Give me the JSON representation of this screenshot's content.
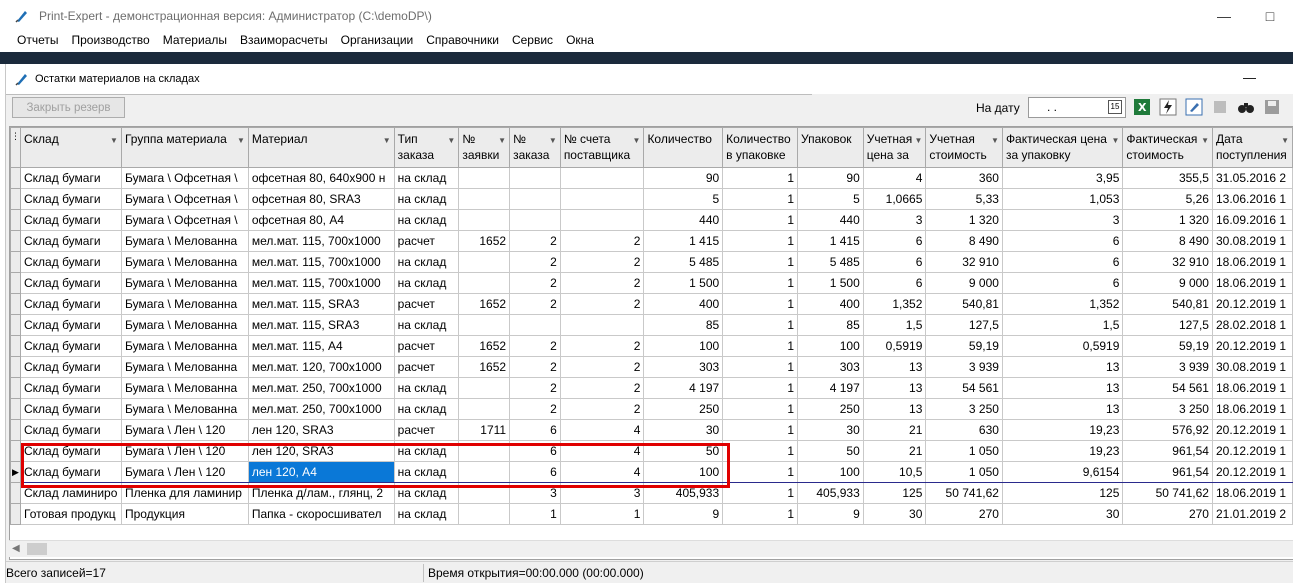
{
  "app": {
    "title": "Print-Expert - демонстрационная версия: Администратор (C:\\demoDP\\)",
    "menu": [
      "Отчеты",
      "Производство",
      "Материалы",
      "Взаиморасчеты",
      "Организации",
      "Справочники",
      "Сервис",
      "Окна"
    ],
    "minimize": "—",
    "maximize": "□"
  },
  "window": {
    "title": "Остатки материалов на складах",
    "minimize": "—"
  },
  "toolbar": {
    "close_reserve_label": "Закрыть резерв",
    "date_label": "На дату",
    "date_value": ". ."
  },
  "grid": {
    "columns": [
      "Склад",
      "Группа материала",
      "Материал",
      "Тип заказа",
      "№ заявки",
      "№ заказа",
      "№ счета поставщика",
      "Количество",
      "Количество в упаковке",
      "Упаковок",
      "Учетная цена за",
      "Учетная стоимость",
      "Фактическая цена за упаковку",
      "Фактическая стоимость",
      "Дата поступления"
    ],
    "rows": [
      [
        "Склад бумаги",
        "Бумага \\ Офсетная \\",
        "офсетная 80, 640х900 н",
        "на склад",
        "",
        "",
        "",
        "90",
        "1",
        "90",
        "4",
        "360",
        "3,95",
        "355,5",
        "31.05.2016 2"
      ],
      [
        "Склад бумаги",
        "Бумага \\ Офсетная \\",
        "офсетная 80, SRA3",
        "на склад",
        "",
        "",
        "",
        "5",
        "1",
        "5",
        "1,0665",
        "5,33",
        "1,053",
        "5,26",
        "13.06.2016 1"
      ],
      [
        "Склад бумаги",
        "Бумага \\ Офсетная \\",
        "офсетная 80, А4",
        "на склад",
        "",
        "",
        "",
        "440",
        "1",
        "440",
        "3",
        "1 320",
        "3",
        "1 320",
        "16.09.2016 1"
      ],
      [
        "Склад бумаги",
        "Бумага \\ Мелованна",
        "мел.мат. 115, 700х1000",
        "расчет",
        "1652",
        "2",
        "2",
        "1 415",
        "1",
        "1 415",
        "6",
        "8 490",
        "6",
        "8 490",
        "30.08.2019 1"
      ],
      [
        "Склад бумаги",
        "Бумага \\ Мелованна",
        "мел.мат. 115, 700х1000",
        "на склад",
        "",
        "2",
        "2",
        "5 485",
        "1",
        "5 485",
        "6",
        "32 910",
        "6",
        "32 910",
        "18.06.2019 1"
      ],
      [
        "Склад бумаги",
        "Бумага \\ Мелованна",
        "мел.мат. 115, 700х1000",
        "на склад",
        "",
        "2",
        "2",
        "1 500",
        "1",
        "1 500",
        "6",
        "9 000",
        "6",
        "9 000",
        "18.06.2019 1"
      ],
      [
        "Склад бумаги",
        "Бумага \\ Мелованна",
        "мел.мат. 115, SRA3",
        "расчет",
        "1652",
        "2",
        "2",
        "400",
        "1",
        "400",
        "1,352",
        "540,81",
        "1,352",
        "540,81",
        "20.12.2019 1"
      ],
      [
        "Склад бумаги",
        "Бумага \\ Мелованна",
        "мел.мат. 115, SRA3",
        "на склад",
        "",
        "",
        "",
        "85",
        "1",
        "85",
        "1,5",
        "127,5",
        "1,5",
        "127,5",
        "28.02.2018 1"
      ],
      [
        "Склад бумаги",
        "Бумага \\ Мелованна",
        "мел.мат. 115, А4",
        "расчет",
        "1652",
        "2",
        "2",
        "100",
        "1",
        "100",
        "0,5919",
        "59,19",
        "0,5919",
        "59,19",
        "20.12.2019 1"
      ],
      [
        "Склад бумаги",
        "Бумага \\ Мелованна",
        "мел.мат. 120, 700х1000",
        "расчет",
        "1652",
        "2",
        "2",
        "303",
        "1",
        "303",
        "13",
        "3 939",
        "13",
        "3 939",
        "30.08.2019 1"
      ],
      [
        "Склад бумаги",
        "Бумага \\ Мелованна",
        "мел.мат. 250, 700х1000",
        "на склад",
        "",
        "2",
        "2",
        "4 197",
        "1",
        "4 197",
        "13",
        "54 561",
        "13",
        "54 561",
        "18.06.2019 1"
      ],
      [
        "Склад бумаги",
        "Бумага \\ Мелованна",
        "мел.мат. 250, 700х1000",
        "на склад",
        "",
        "2",
        "2",
        "250",
        "1",
        "250",
        "13",
        "3 250",
        "13",
        "3 250",
        "18.06.2019 1"
      ],
      [
        "Склад бумаги",
        "Бумага \\ Лен \\ 120",
        "лен 120, SRA3",
        "расчет",
        "1711",
        "6",
        "4",
        "30",
        "1",
        "30",
        "21",
        "630",
        "19,23",
        "576,92",
        "20.12.2019 1"
      ],
      [
        "Склад бумаги",
        "Бумага \\ Лен \\ 120",
        "лен 120, SRA3",
        "на склад",
        "",
        "6",
        "4",
        "50",
        "1",
        "50",
        "21",
        "1 050",
        "19,23",
        "961,54",
        "20.12.2019 1"
      ],
      [
        "Склад бумаги",
        "Бумага \\ Лен \\ 120",
        "лен 120, А4",
        "на склад",
        "",
        "6",
        "4",
        "100",
        "1",
        "100",
        "10,5",
        "1 050",
        "9,6154",
        "961,54",
        "20.12.2019 1"
      ],
      [
        "Склад ламиниро",
        "Пленка для ламинир",
        "Пленка д/лам., глянц, 2",
        "на склад",
        "",
        "3",
        "3",
        "405,933",
        "1",
        "405,933",
        "125",
        "50 741,62",
        "125",
        "50 741,62",
        "18.06.2019 1"
      ],
      [
        "Готовая продукц",
        "Продукция",
        "Папка - скоросшивател",
        "на склад",
        "",
        "1",
        "1",
        "9",
        "1",
        "9",
        "30",
        "270",
        "30",
        "270",
        "21.01.2019 2"
      ]
    ],
    "selected_row_index": 14,
    "current_row_marker": "▶"
  },
  "status": {
    "records": "Всего записей=17",
    "open_time": "Время открытия=00:00.000 (00:00.000)"
  },
  "icons": {
    "app_icon": "pen-icon",
    "excel_icon": "excel-icon",
    "lightning_icon": "lightning-icon",
    "edit_icon": "edit-icon",
    "binoculars_icon": "binoculars-icon",
    "save_icon": "save-icon"
  },
  "colors": {
    "selection": "#0a78d7",
    "highlight_border": "#e00000"
  }
}
